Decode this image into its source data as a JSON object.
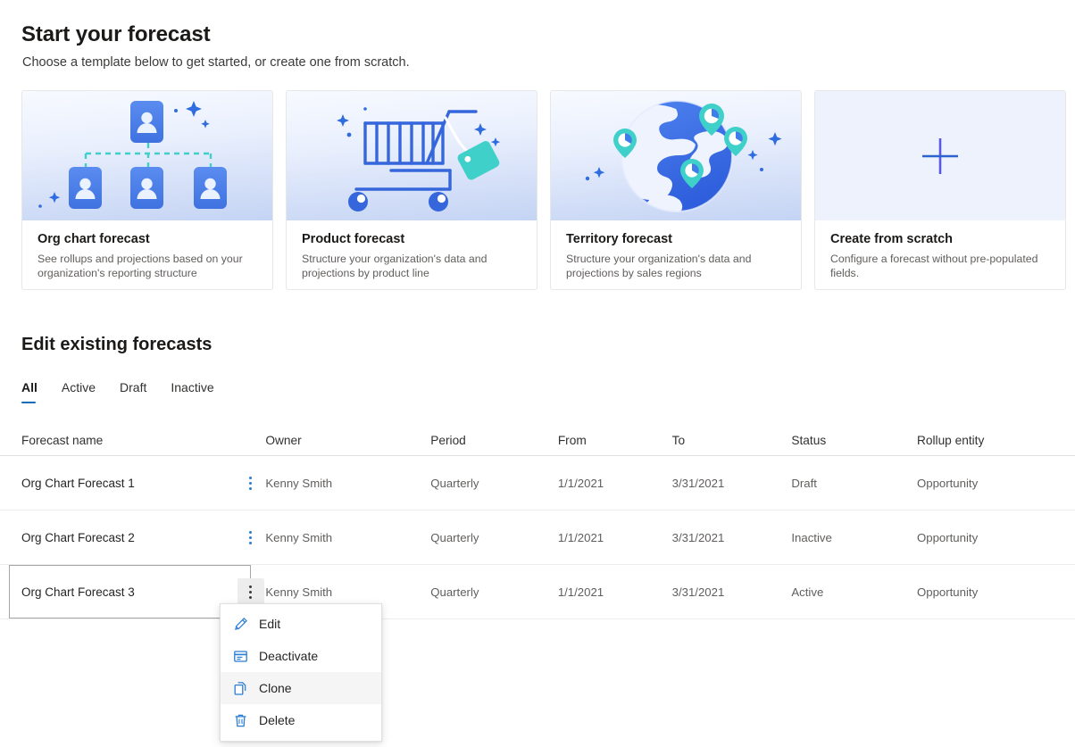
{
  "header": {
    "title": "Start your forecast",
    "subtitle": "Choose a template below to get started, or create one from scratch."
  },
  "templates": [
    {
      "art": "org-chart-illustration",
      "title": "Org chart forecast",
      "description": "See rollups and projections based on your organization's reporting structure"
    },
    {
      "art": "shopping-cart-illustration",
      "title": "Product forecast",
      "description": "Structure your organization's data and projections by product line"
    },
    {
      "art": "globe-pins-illustration",
      "title": "Territory forecast",
      "description": "Structure your organization's data and projections by sales regions"
    },
    {
      "art": "plus-icon",
      "title": "Create from scratch",
      "description": "Configure a forecast without pre-populated fields."
    }
  ],
  "existing": {
    "section_title": "Edit existing forecasts",
    "tabs": [
      {
        "label": "All",
        "selected": true
      },
      {
        "label": "Active",
        "selected": false
      },
      {
        "label": "Draft",
        "selected": false
      },
      {
        "label": "Inactive",
        "selected": false
      }
    ],
    "columns": [
      "Forecast name",
      "Owner",
      "Period",
      "From",
      "To",
      "Status",
      "Rollup entity"
    ],
    "rows": [
      {
        "name": "Org Chart Forecast 1",
        "owner": "Kenny Smith",
        "period": "Quarterly",
        "from": "1/1/2021",
        "to": "3/31/2021",
        "status": "Draft",
        "rollup": "Opportunity"
      },
      {
        "name": "Org Chart Forecast 2",
        "owner": "Kenny Smith",
        "period": "Quarterly",
        "from": "1/1/2021",
        "to": "3/31/2021",
        "status": "Inactive",
        "rollup": "Opportunity"
      },
      {
        "name": "Org Chart Forecast 3",
        "owner": "Kenny Smith",
        "period": "Quarterly",
        "from": "1/1/2021",
        "to": "3/31/2021",
        "status": "Active",
        "rollup": "Opportunity"
      }
    ]
  },
  "context_menu": {
    "open_for_row": "Org Chart Forecast 3",
    "items": [
      {
        "label": "Edit",
        "icon": "pencil-icon",
        "hovered": false
      },
      {
        "label": "Deactivate",
        "icon": "deactivate-icon",
        "hovered": false
      },
      {
        "label": "Clone",
        "icon": "copy-icon",
        "hovered": true
      },
      {
        "label": "Delete",
        "icon": "trash-icon",
        "hovered": false
      }
    ]
  },
  "colors": {
    "accent": "#0f6cbd",
    "illustration_blue": "#4a7fe8",
    "illustration_teal": "#3fd0c9",
    "card_border": "#e7e7e7",
    "row_divider": "#ededed",
    "text_primary": "#1b1a19",
    "text_secondary": "#605e5c"
  }
}
